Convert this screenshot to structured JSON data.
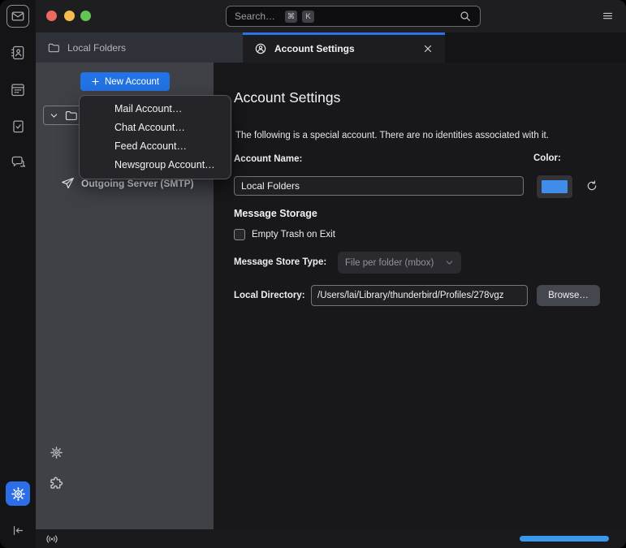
{
  "titlebar": {
    "search": {
      "placeholder": "Search…",
      "keys": [
        "⌘",
        "K"
      ]
    }
  },
  "spaces": {
    "items": [
      "mail",
      "address-book",
      "calendar",
      "tasks",
      "chat"
    ],
    "footer": [
      "settings",
      "collapse-spaces"
    ]
  },
  "tabs": [
    {
      "label": "Local Folders",
      "icon": "folder",
      "active": false
    },
    {
      "label": "Account Settings",
      "icon": "account-settings",
      "active": true,
      "closable": true
    }
  ],
  "sidebar": {
    "new_account_button": "New Account",
    "outgoing_server": "Outgoing Server (SMTP)"
  },
  "menu": {
    "items": [
      "Mail Account…",
      "Chat Account…",
      "Feed Account…",
      "Newsgroup Account…"
    ]
  },
  "main": {
    "title": "Account Settings",
    "description": "The following is a special account. There are no identities associated with it.",
    "account_name_label": "Account Name:",
    "account_name_value": "Local Folders",
    "color_label": "Color:",
    "color_value": "#3f8de8",
    "storage": {
      "heading": "Message Storage",
      "empty_trash_label": "Empty Trash on Exit",
      "empty_trash_checked": false,
      "store_type_label": "Message Store Type:",
      "store_type_value": "File per folder (mbox)",
      "local_dir_label": "Local Directory:",
      "local_dir_value": "/Users/lai/Library/thunderbird/Profiles/278vgz",
      "browse_label": "Browse…"
    }
  },
  "statusbar": {
    "progress_color": "#3898ec"
  },
  "colors": {
    "accent_blue": "#2b73eb",
    "button_blue": "#2273e5",
    "left_panel_bg": "#3f4147",
    "main_bg": "#18181a",
    "traffic": [
      "#ee6a5f",
      "#f5bd4f",
      "#61c454"
    ]
  }
}
